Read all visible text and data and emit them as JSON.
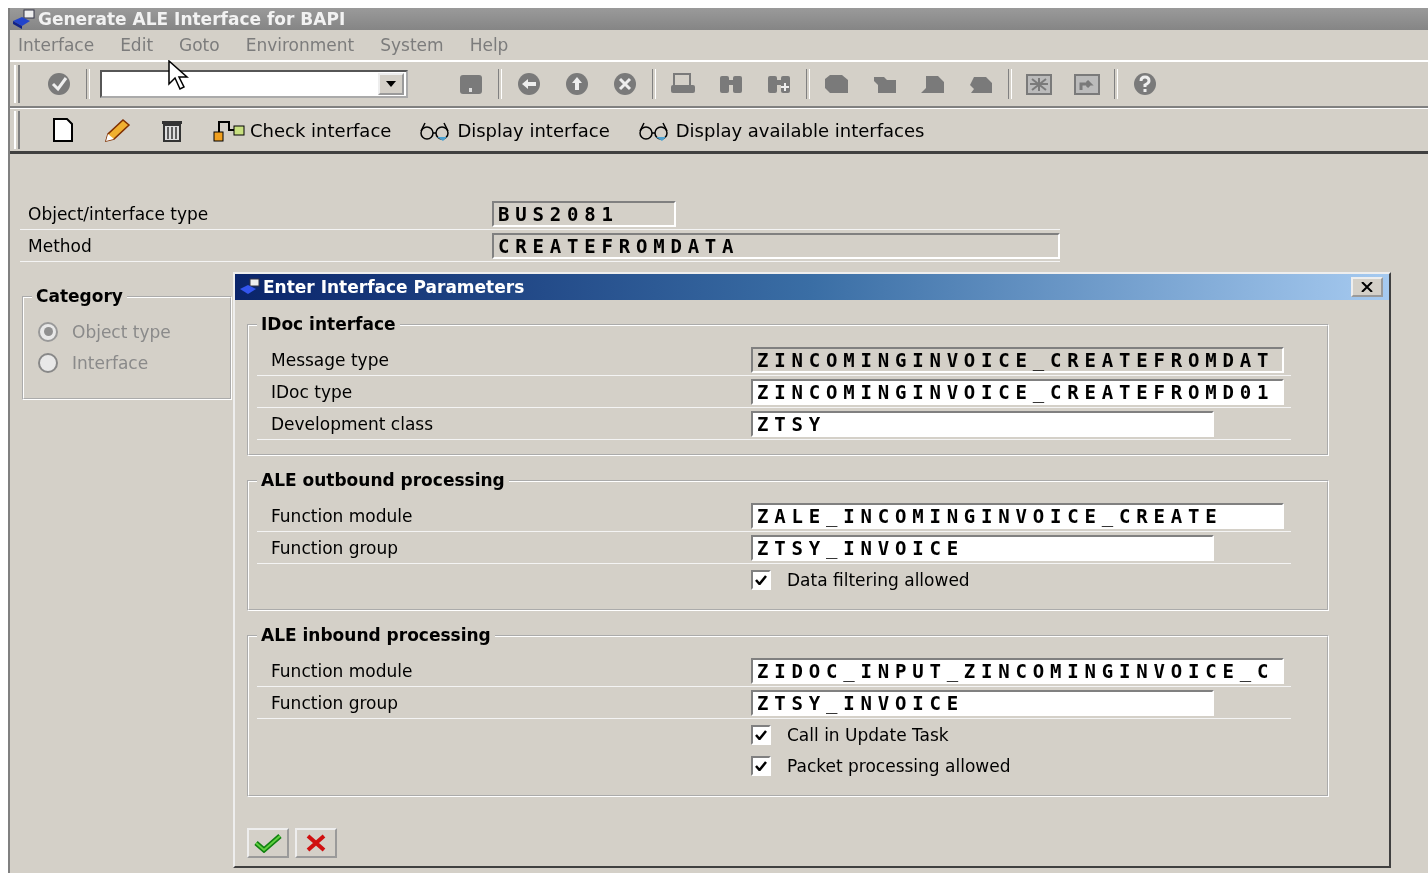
{
  "window": {
    "title": "Generate ALE Interface for BAPI"
  },
  "menu": [
    "Interface",
    "Edit",
    "Goto",
    "Environment",
    "System",
    "Help"
  ],
  "app_toolbar": [
    {
      "kind": "create"
    },
    {
      "kind": "change"
    },
    {
      "kind": "delete"
    },
    {
      "kind": "check",
      "label": "Check interface"
    },
    {
      "kind": "display",
      "label": "Display interface"
    },
    {
      "kind": "display",
      "label": "Display available interfaces"
    }
  ],
  "header_fields": [
    {
      "label": "Object/interface type",
      "value": "BUS2081",
      "readonly": true
    },
    {
      "label": "Method",
      "value": "CREATEFROMDATA",
      "readonly": true
    }
  ],
  "category": {
    "title": "Category",
    "disabled": true,
    "options": [
      {
        "label": "Object type",
        "selected": true
      },
      {
        "label": "Interface",
        "selected": false
      }
    ]
  },
  "dialog": {
    "title": "Enter Interface Parameters",
    "groups": [
      {
        "title": "IDoc interface",
        "rows": [
          {
            "kind": "field",
            "label": "Message type",
            "value": "ZINCOMINGINVOICE_CREATEFROMDAT",
            "readonly": true
          },
          {
            "kind": "field",
            "label": "IDoc type",
            "value": "ZINCOMINGINVOICE_CREATEFROMD01",
            "readonly": false
          },
          {
            "kind": "field",
            "label": "Development class",
            "value": "ZTSY",
            "readonly": false
          }
        ]
      },
      {
        "title": "ALE outbound processing",
        "rows": [
          {
            "kind": "field",
            "label": "Function module",
            "value": "ZALE_INCOMINGINVOICE_CREATE",
            "readonly": false
          },
          {
            "kind": "field",
            "label": "Function group",
            "value": "ZTSY_INVOICE",
            "readonly": false
          },
          {
            "kind": "checkbox",
            "label": "Data filtering allowed",
            "checked": true
          }
        ]
      },
      {
        "title": "ALE inbound processing",
        "rows": [
          {
            "kind": "field",
            "label": "Function module",
            "value": "ZIDOC_INPUT_ZINCOMINGINVOICE_C",
            "readonly": false
          },
          {
            "kind": "field",
            "label": "Function group",
            "value": "ZTSY_INVOICE",
            "readonly": false
          },
          {
            "kind": "checkbox",
            "label": "Call in Update Task",
            "checked": true
          },
          {
            "kind": "checkbox",
            "label": "Packet processing allowed",
            "checked": true
          }
        ]
      }
    ]
  }
}
